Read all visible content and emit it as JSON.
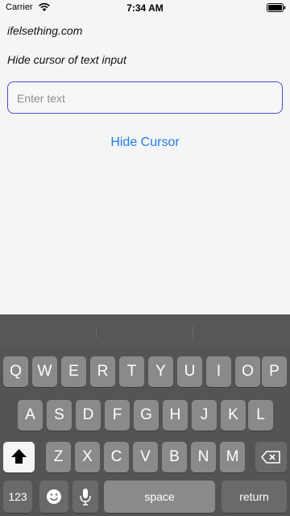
{
  "status_bar": {
    "carrier": "Carrier",
    "time": "7:34 AM"
  },
  "page": {
    "site_title": "ifelsething.com",
    "subtitle": "Hide cursor of text input",
    "input_placeholder": "Enter text",
    "button_label": "Hide Cursor"
  },
  "keyboard": {
    "row1": [
      "Q",
      "W",
      "E",
      "R",
      "T",
      "Y",
      "U",
      "I",
      "O",
      "P"
    ],
    "row2": [
      "A",
      "S",
      "D",
      "F",
      "G",
      "H",
      "J",
      "K",
      "L"
    ],
    "row3": [
      "Z",
      "X",
      "C",
      "V",
      "B",
      "N",
      "M"
    ],
    "numbers_label": "123",
    "space_label": "space",
    "return_label": "return",
    "shift_icon": "shift-icon",
    "backspace_icon": "backspace-icon",
    "emoji_icon": "emoji-icon",
    "mic_icon": "microphone-icon"
  },
  "colors": {
    "accent": "#1e7bf3",
    "input_border": "#4a4ad6",
    "keyboard_bg": "#545454"
  }
}
